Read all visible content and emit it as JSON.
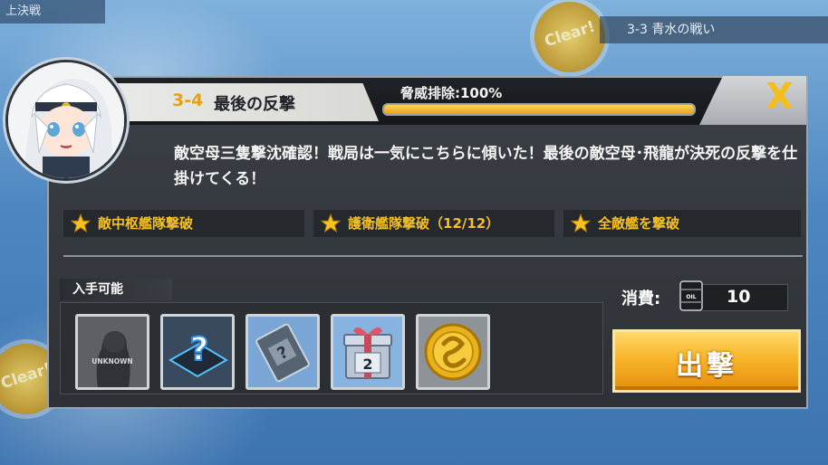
{
  "background": {
    "top_label": "上決戦",
    "clear_badge": "Clear!",
    "stage_header": "3-3 青水の戦い"
  },
  "stage": {
    "number": "3-4",
    "name": "最後の反撃",
    "threat_label": "脅威排除:",
    "threat_value": "100%",
    "threat_fraction": 1.0
  },
  "description": "敵空母三隻撃沈確認！戦局は一気にこちらに傾いた！最後の敵空母･飛龍が決死の反撃を仕掛けてくる！",
  "conditions": [
    {
      "label": "敵中枢艦隊撃破"
    },
    {
      "label": "護衛艦隊撃破（12/12）"
    },
    {
      "label": "全敵艦を撃破"
    }
  ],
  "rewards": {
    "title": "入手可能",
    "items": [
      {
        "name": "unknown-ship",
        "label": "UNKNOWN"
      },
      {
        "name": "mystery-item",
        "label": ""
      },
      {
        "name": "mystery-book",
        "label": ""
      },
      {
        "name": "tech-box",
        "label": "2"
      },
      {
        "name": "gold-coin",
        "label": ""
      }
    ]
  },
  "cost": {
    "label": "消費:",
    "icon": "oil-barrel-icon",
    "icon_text": "OIL",
    "value": "10"
  },
  "sortie_button": "出撃",
  "close_button": "X",
  "colors": {
    "accent": "#f4c026",
    "stage_number": "#e2a11a",
    "sortie": "#f7b52a"
  }
}
